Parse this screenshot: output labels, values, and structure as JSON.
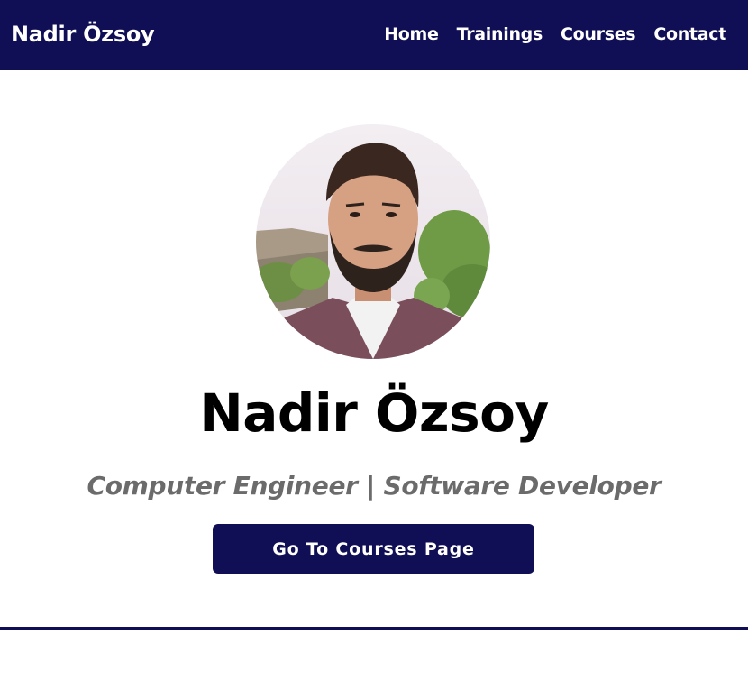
{
  "header": {
    "brand": "Nadir Özsoy",
    "nav": [
      {
        "label": "Home"
      },
      {
        "label": "Trainings"
      },
      {
        "label": "Courses"
      },
      {
        "label": "Contact"
      }
    ]
  },
  "hero": {
    "avatar_icon": "profile-photo",
    "name": "Nadir Özsoy",
    "subtitle": "Computer Engineer | Software Developer",
    "cta_label": "Go To Courses Page"
  },
  "colors": {
    "primary": "#100e54",
    "subtitle": "#6b6b6b",
    "background": "#ffffff"
  }
}
